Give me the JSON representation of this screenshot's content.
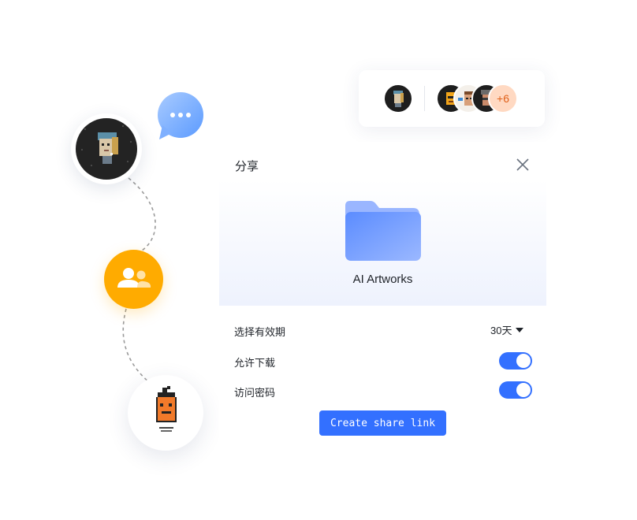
{
  "participants": {
    "more_count": "+6"
  },
  "share_dialog": {
    "title": "分享",
    "folder_name": "AI Artworks",
    "expiry": {
      "label": "选择有效期",
      "value": "30天"
    },
    "allow_download": {
      "label": "允许下载",
      "enabled": true
    },
    "access_password": {
      "label": "访问密码",
      "enabled": true
    },
    "create_button_label": "Create share link"
  },
  "colors": {
    "accent": "#3370ff",
    "group_badge": "#ffab00",
    "chat_bubble": "#7aaeff",
    "more_badge_bg": "#ffd9c2",
    "more_badge_text": "#e0611a"
  },
  "icons": {
    "chat": "chat-bubble-icon",
    "group": "group-icon",
    "folder": "folder-icon",
    "close": "close-icon",
    "dropdown": "caret-down-icon"
  }
}
